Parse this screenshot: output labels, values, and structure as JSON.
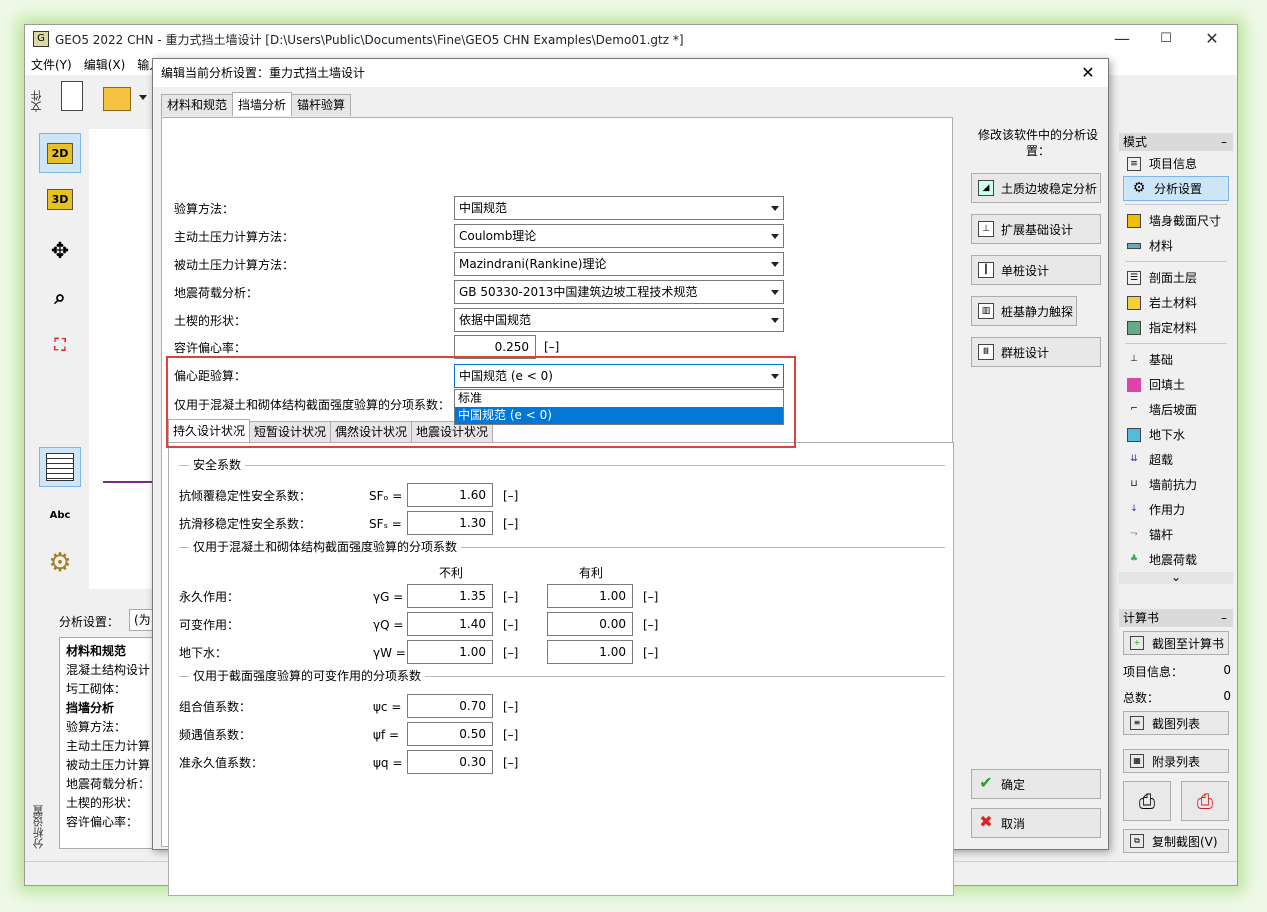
{
  "window": {
    "title": "GEO5 2022 CHN - 重力式挡土墙设计 [D:\\Users\\Public\\Documents\\Fine\\GEO5 CHN Examples\\Demo01.gtz *]",
    "min": "—",
    "max": "☐",
    "close": "✕"
  },
  "menu": [
    "文件(Y)",
    "编辑(X)",
    "输入"
  ],
  "left_tab": "文件",
  "left_buttons": {
    "b2d": "2D",
    "b3d": "3D"
  },
  "bottom_panel": {
    "vtab": "分析设置",
    "label": "分析设置：",
    "combo": "(为当前",
    "lines": [
      "材料和规范",
      "混凝土结构设计",
      "圬工砌体：",
      "挡墙分析",
      "验算方法：",
      "主动土压力计算",
      "被动土压力计算",
      "地震荷载分析：",
      "土楔的形状：",
      "容许偏心率："
    ]
  },
  "right_panel": {
    "mode_header": "模式",
    "items": [
      "项目信息",
      "分析设置",
      "墙身截面尺寸",
      "材料",
      "剖面土层",
      "岩土材料",
      "指定材料",
      "基础",
      "回填土",
      "墙后坡面",
      "地下水",
      "超载",
      "墙前抗力",
      "作用力",
      "锚杆",
      "地震荷载"
    ],
    "calc_header": "计算书",
    "to_report": "截图至计算书",
    "proj_info_label": "项目信息：",
    "proj_info_val": "0",
    "total_label": "总数：",
    "total_val": "0",
    "shot_list": "截图列表",
    "appendix": "附录列表",
    "copy_shot": "复制截图(V)"
  },
  "dialog": {
    "title": "编辑当前分析设置：重力式挡土墙设计",
    "close": "✕",
    "tabs": [
      "材料和规范",
      "挡墙分析",
      "锚杆验算"
    ],
    "fields": [
      {
        "label": "验算方法：",
        "value": "中国规范"
      },
      {
        "label": "主动土压力计算方法：",
        "value": "Coulomb理论"
      },
      {
        "label": "被动土压力计算方法：",
        "value": "Mazindrani(Rankine)理论"
      },
      {
        "label": "地震荷载分析：",
        "value": "GB 50330-2013中国建筑边坡工程技术规范"
      },
      {
        "label": "土楔的形状：",
        "value": "依据中国规范"
      }
    ],
    "ecc_label": "容许偏心率：",
    "ecc_value": "0.250",
    "ecc_unit": "[–]",
    "ecc_check_label": "偏心距验算：",
    "ecc_check_value": "中国规范 (e < 0)",
    "dropdown": [
      "标准",
      "中国规范 (e < 0)"
    ],
    "partial_label": "仅用于混凝土和砌体结构截面强度验算的分项系数：",
    "subtabs": [
      "持久设计状况",
      "短暂设计状况",
      "偶然设计状况",
      "地震设计状况"
    ],
    "safety_header": "安全系数",
    "safety": [
      {
        "label": "抗倾覆稳定性安全系数：",
        "sym": "SFₒ =",
        "val": "1.60",
        "unit": "[–]"
      },
      {
        "label": "抗滑移稳定性安全系数：",
        "sym": "SFₛ =",
        "val": "1.30",
        "unit": "[–]"
      }
    ],
    "partial_header": "仅用于混凝土和砌体结构截面强度验算的分项系数",
    "col_unfav": "不利",
    "col_fav": "有利",
    "partial": [
      {
        "label": "永久作用：",
        "sym": "γG =",
        "unfav": "1.35",
        "fav": "1.00"
      },
      {
        "label": "可变作用：",
        "sym": "γQ =",
        "unfav": "1.40",
        "fav": "0.00"
      },
      {
        "label": "地下水：",
        "sym": "γW =",
        "unfav": "1.00",
        "fav": "1.00"
      }
    ],
    "unit": "[–]",
    "comb_header": "仅用于截面强度验算的可变作用的分项系数",
    "comb": [
      {
        "label": "组合值系数：",
        "sym": "ψc =",
        "val": "0.70"
      },
      {
        "label": "频遇值系数：",
        "sym": "ψf =",
        "val": "0.50"
      },
      {
        "label": "准永久值系数：",
        "sym": "ψq =",
        "val": "0.30"
      }
    ],
    "side_hint": "修改该软件中的分析设置：",
    "side_buttons": [
      "土质边坡稳定分析",
      "扩展基础设计",
      "单桩设计",
      "桩基静力触探",
      "群桩设计"
    ],
    "ok": "确定",
    "cancel": "取消"
  }
}
